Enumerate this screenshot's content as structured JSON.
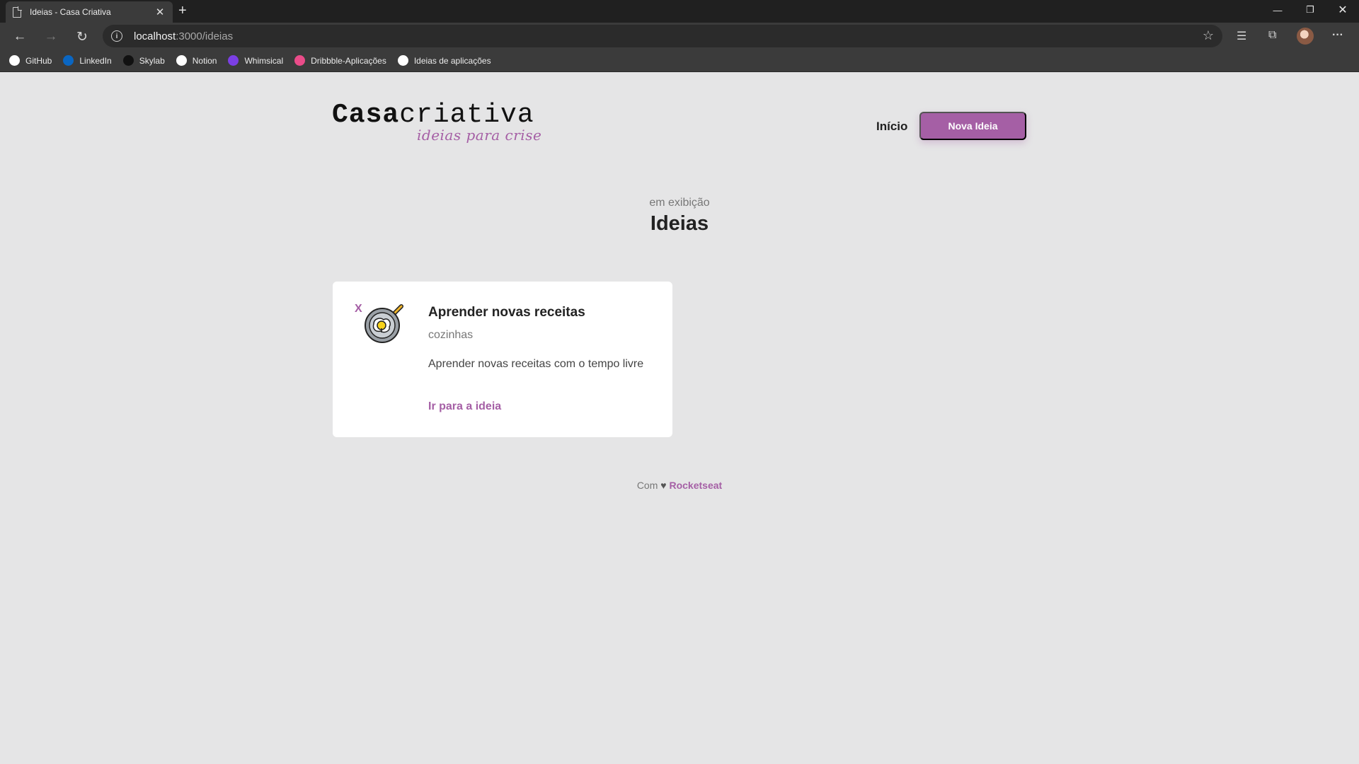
{
  "browser": {
    "tab_title": "Ideias - Casa Criativa",
    "tab_close": "✕",
    "new_tab": "+",
    "url_host": "localhost",
    "url_path": ":3000/ideias",
    "bookmarks": [
      {
        "label": "GitHub",
        "icon": "github-icon",
        "color": "#ffffff"
      },
      {
        "label": "LinkedIn",
        "icon": "linkedin-icon",
        "color": "#0a66c2"
      },
      {
        "label": "Skylab",
        "icon": "skylab-icon",
        "color": "#111111"
      },
      {
        "label": "Notion",
        "icon": "notion-icon",
        "color": "#ffffff"
      },
      {
        "label": "Whimsical",
        "icon": "whimsical-icon",
        "color": "#7b3fe4"
      },
      {
        "label": "Dribbble-Aplicações",
        "icon": "dribbble-icon",
        "color": "#ea4c89"
      },
      {
        "label": "Ideias de aplicações",
        "icon": "github-icon",
        "color": "#ffffff"
      }
    ]
  },
  "header": {
    "logo_bold": "Casa",
    "logo_light": "criativa",
    "logo_tagline": "ideias para crise",
    "nav_home": "Início",
    "new_idea_button": "Nova Ideia"
  },
  "section": {
    "subtitle": "em exibição",
    "title": "Ideias"
  },
  "ideas": [
    {
      "remove": "X",
      "icon": "frying-pan-egg-icon",
      "title": "Aprender novas receitas",
      "category": "cozinhas",
      "description": "Aprender novas receitas com o tempo livre",
      "link": "Ir para a ideia"
    }
  ],
  "footer": {
    "prefix": "Com",
    "heart": "♥",
    "brand": "Rocketseat"
  },
  "colors": {
    "accent": "#a55fa5",
    "background": "#e5e5e6",
    "card": "#ffffff"
  }
}
